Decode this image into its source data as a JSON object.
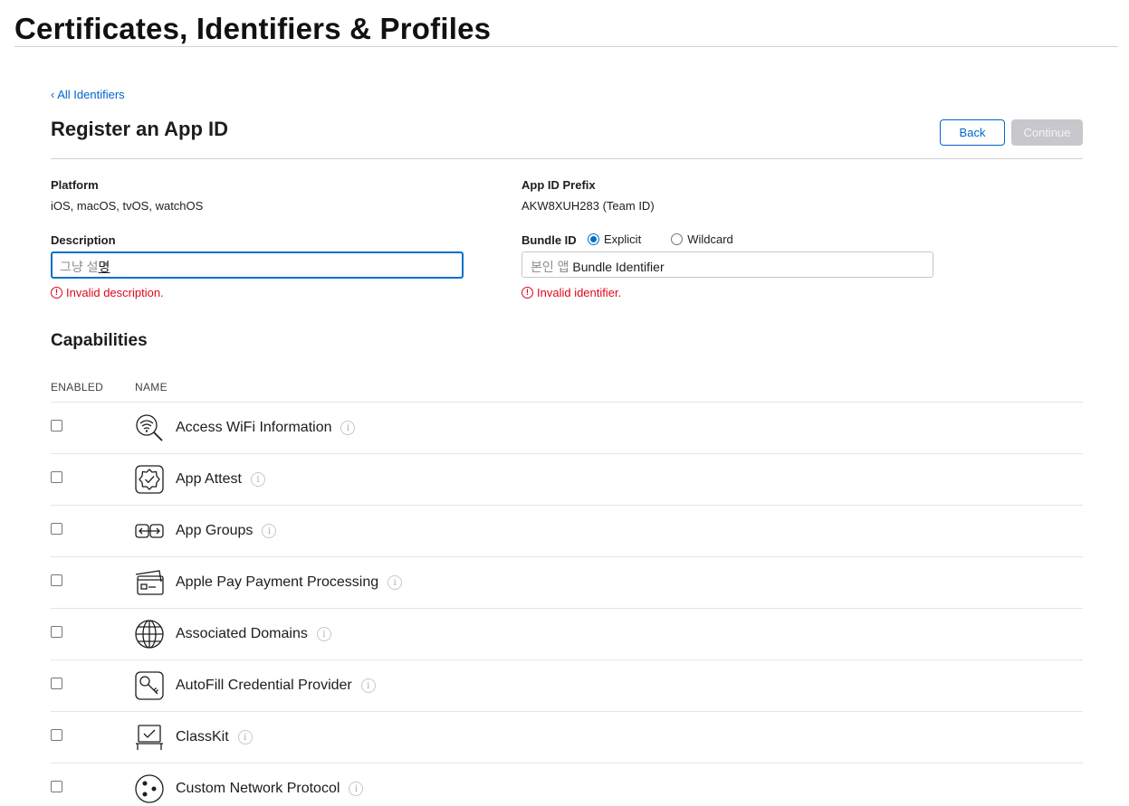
{
  "header": {
    "title": "Certificates, Identifiers & Profiles"
  },
  "nav": {
    "back_link": "‹ All Identifiers"
  },
  "form": {
    "title": "Register an App ID",
    "back_button": "Back",
    "continue_button": "Continue",
    "platform_label": "Platform",
    "platform_value": "iOS, macOS, tvOS, watchOS",
    "prefix_label": "App ID Prefix",
    "prefix_value": "AKW8XUH283 (Team ID)",
    "description_label": "Description",
    "description_placeholder": "그냥 설",
    "description_ime": "명",
    "description_error": "Invalid description.",
    "bundle_label": "Bundle ID",
    "bundle_options": {
      "explicit": "Explicit",
      "wildcard": "Wildcard",
      "selected": "Explicit"
    },
    "bundle_prefix_hint": "본인 앱 ",
    "bundle_value": "Bundle Identifier",
    "bundle_error": "Invalid identifier.",
    "error_icon": "!"
  },
  "capabilities": {
    "title": "Capabilities",
    "col_enabled": "ENABLED",
    "col_name": "NAME",
    "items": [
      {
        "name": "Access WiFi Information",
        "icon": "wifi-search-icon",
        "enabled": false
      },
      {
        "name": "App Attest",
        "icon": "badge-check-icon",
        "enabled": false
      },
      {
        "name": "App Groups",
        "icon": "app-groups-icon",
        "enabled": false
      },
      {
        "name": "Apple Pay Payment Processing",
        "icon": "credit-card-icon",
        "enabled": false
      },
      {
        "name": "Associated Domains",
        "icon": "globe-icon",
        "enabled": false
      },
      {
        "name": "AutoFill Credential Provider",
        "icon": "key-icon",
        "enabled": false
      },
      {
        "name": "ClassKit",
        "icon": "classkit-icon",
        "enabled": false
      },
      {
        "name": "Custom Network Protocol",
        "icon": "network-dots-icon",
        "enabled": false
      }
    ],
    "info_glyph": "i"
  },
  "colors": {
    "link": "#0066cc",
    "error": "#de071c",
    "focus": "#0070c9",
    "disabled": "#c7c7cc"
  }
}
